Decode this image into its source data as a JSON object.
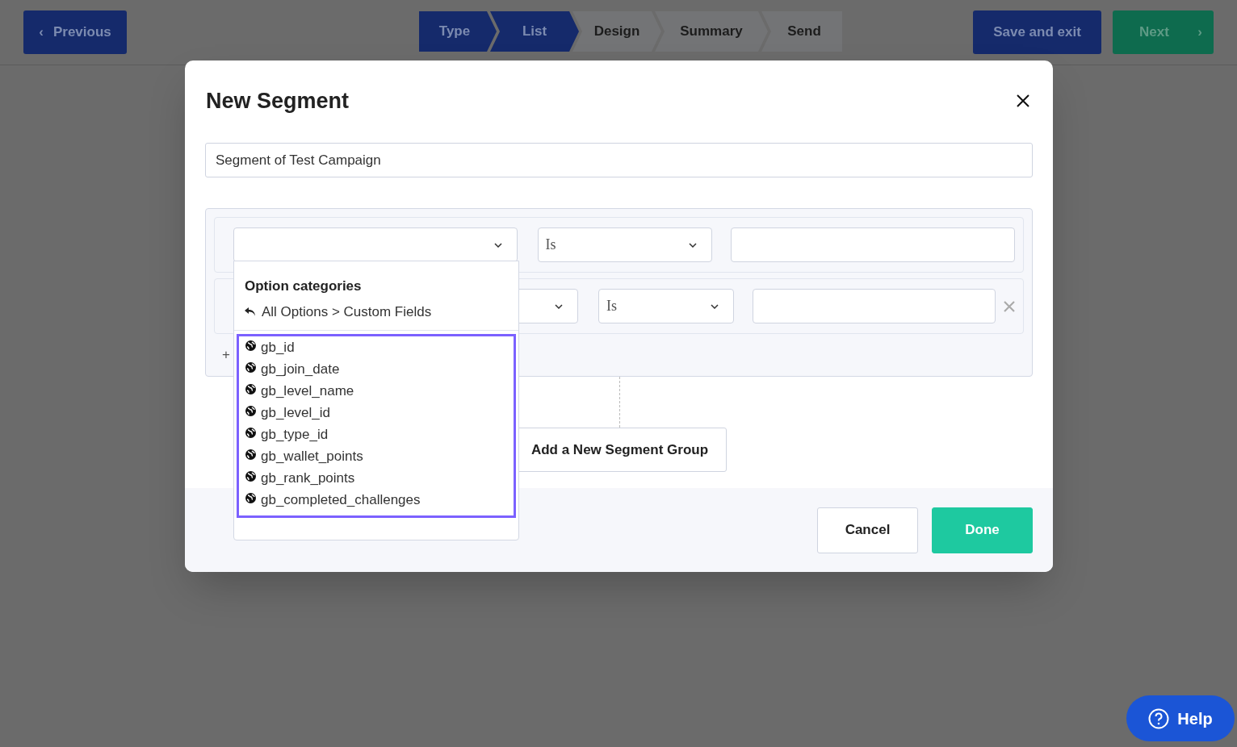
{
  "topbar": {
    "previous": {
      "label": "Previous",
      "icon": "‹"
    },
    "steps": [
      {
        "label": "Type",
        "completed": true
      },
      {
        "label": "List",
        "completed": true
      },
      {
        "label": "Design",
        "completed": false
      },
      {
        "label": "Summary",
        "completed": false
      },
      {
        "label": "Send",
        "completed": false
      }
    ],
    "save": {
      "label": "Save and exit"
    },
    "next": {
      "label": "Next",
      "icon": "›"
    }
  },
  "modal": {
    "title": "New Segment",
    "name_field": {
      "value": "Segment of Test Campaign"
    },
    "conditions": [
      {
        "operator": "Is",
        "removable": false
      },
      {
        "operator": "Is",
        "removable": true
      }
    ],
    "add_condition": {
      "label": "+"
    },
    "dropdown": {
      "heading": "Option categories",
      "breadcrumb": "All Options > Custom Fields",
      "highlighted": true,
      "options": [
        "gb_id",
        "gb_join_date",
        "gb_level_name",
        "gb_level_id",
        "gb_type_id",
        "gb_wallet_points",
        "gb_rank_points",
        "gb_completed_challenges"
      ]
    },
    "add_group": {
      "label": "Add a New Segment Group"
    },
    "buttons": [
      {
        "label": "Cancel",
        "kind": "secondary"
      },
      {
        "label": "Done",
        "kind": "primary"
      }
    ]
  },
  "help": {
    "label": "Help"
  }
}
